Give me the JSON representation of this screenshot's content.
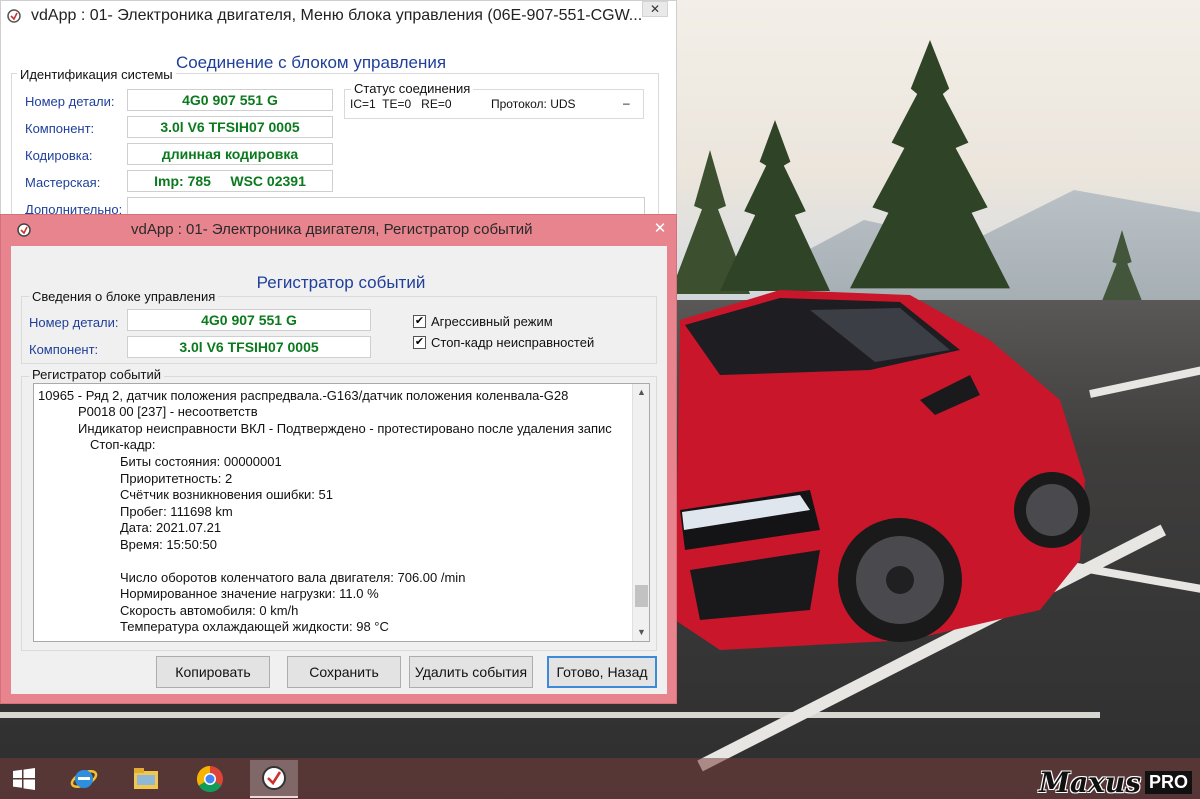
{
  "back_window": {
    "title": "vdApp : 01- Электроника двигателя,  Меню блока управления (06E-907-551-CGW...",
    "close_label": "✕",
    "heading": "Соединение с блоком управления",
    "identification": {
      "group_label": "Идентификация системы",
      "fields": [
        {
          "label": "Номер детали:",
          "value": "4G0 907 551 G"
        },
        {
          "label": "Компонент:",
          "value": "3.0l V6 TFSIH07 0005"
        },
        {
          "label": "Кодировка:",
          "value": "длинная кодировка"
        },
        {
          "label": "Мастерская:",
          "value": "Imp: 785     WSC 02391"
        },
        {
          "label": "Дополнительно:",
          "value": ""
        }
      ]
    },
    "connection_status": {
      "group_label": "Статус соединения",
      "values": "IC=1  TE=0   RE=0",
      "protocol": "Протокол: UDS",
      "extra": "–"
    }
  },
  "event_window": {
    "title": "vdApp : 01- Электроника двигателя,  Регистратор событий",
    "close_label": "✕",
    "heading": "Регистратор событий",
    "ecu_info": {
      "group_label": "Сведения о блоке управления",
      "fields": [
        {
          "label": "Номер детали:",
          "value": "4G0 907 551 G"
        },
        {
          "label": "Компонент:",
          "value": "3.0l V6 TFSIH07 0005"
        }
      ]
    },
    "options": [
      {
        "label": "Агрессивный режим",
        "checked": true
      },
      {
        "label": "Стоп-кадр неисправностей",
        "checked": true
      }
    ],
    "check_mark": "✔",
    "log_group_label": "Регистратор событий",
    "log_lines": [
      "10965 - Ряд 2, датчик положения распредвала.-G163/датчик положения коленвала-G28",
      "P0018 00 [237] - несоответств",
      "Индикатор неисправности ВКЛ - Подтверждено - протестировано после удаления запис",
      "Стоп-кадр:",
      "Биты состояния: 00000001",
      "Приоритетность: 2",
      "Счётчик возникновения ошибки: 51",
      "Пробег: 111698 km",
      "Дата: 2021.07.21",
      "Время: 15:50:50",
      "",
      "Число оборотов коленчатого вала двигателя: 706.00 /min",
      "Нормированное значение нагрузки: 11.0 %",
      "Скорость автомобиля: 0 km/h",
      "Температура охлаждающей жидкости: 98 °C"
    ],
    "scroll_up": "▲",
    "scroll_down": "▼",
    "buttons": {
      "copy": "Копировать",
      "save": "Сохранить",
      "delete": "Удалить события",
      "done": "Готово, Назад"
    }
  },
  "taskbar": {
    "items": [
      "start",
      "internet-explorer",
      "file-explorer",
      "chrome",
      "vdapp"
    ]
  },
  "watermark": {
    "text": "Maxus",
    "badge": "PRO"
  },
  "colors": {
    "label_blue": "#1f3f9a",
    "value_green": "#0b7a1e",
    "active_window_frame": "#e8848e",
    "button_focus": "#3c8ad8"
  }
}
